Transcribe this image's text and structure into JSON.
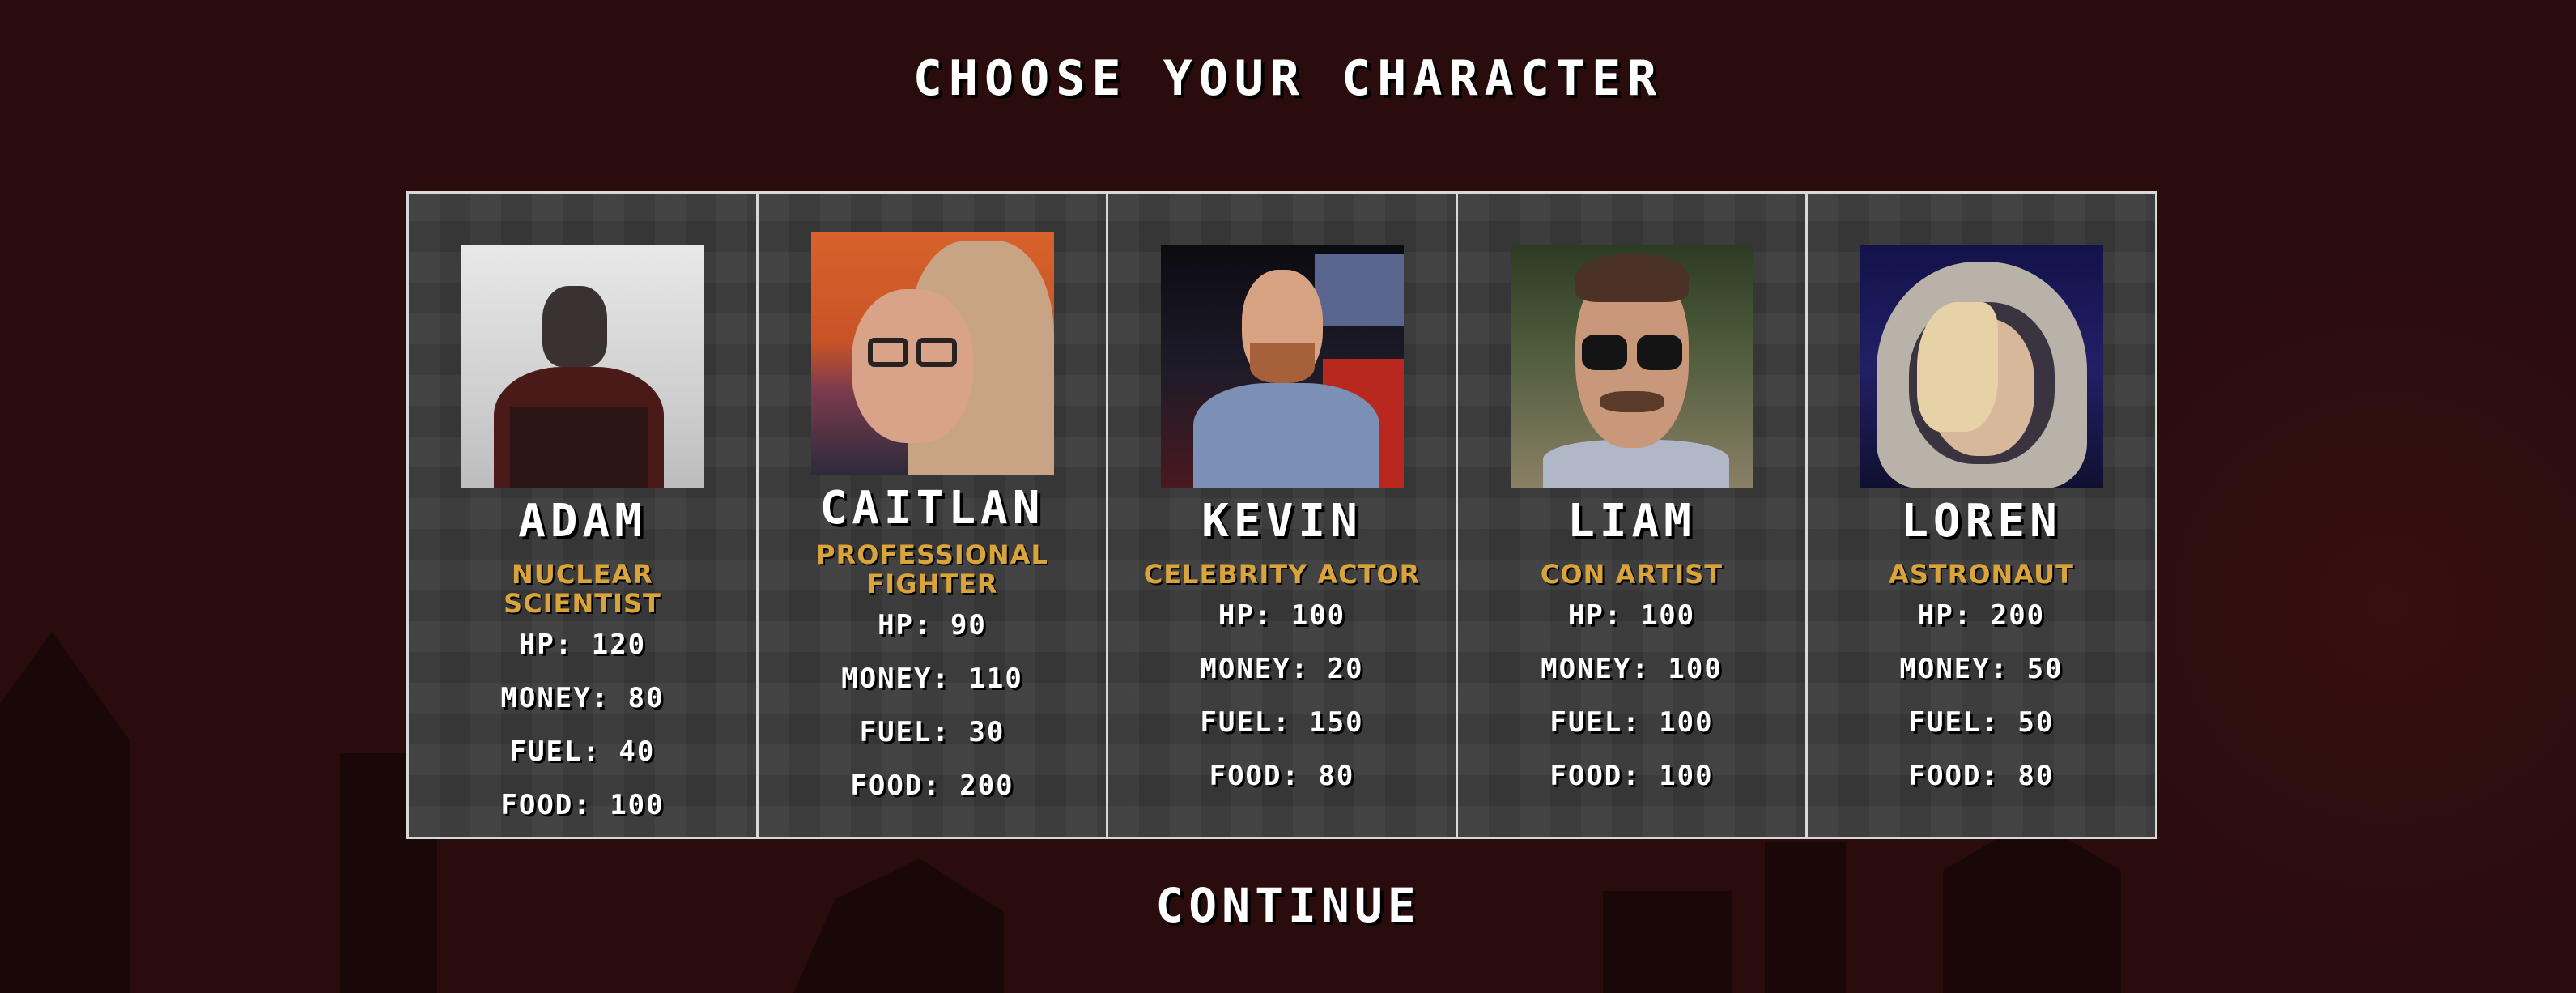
{
  "screen": {
    "title": "CHOOSE YOUR CHARACTER",
    "continue_label": "CONTINUE"
  },
  "characters": [
    {
      "name": "ADAM",
      "role": "NUCLEAR SCIENTIST",
      "hp": "HP: 120",
      "money": "MONEY: 80",
      "fuel": "FUEL: 40",
      "food": "FOOD: 100"
    },
    {
      "name": "CAITLAN",
      "role": "PROFESSIONAL FIGHTER",
      "hp": "HP: 90",
      "money": "MONEY: 110",
      "fuel": "FUEL: 30",
      "food": "FOOD: 200"
    },
    {
      "name": "KEVIN",
      "role": "CELEBRITY ACTOR",
      "hp": "HP: 100",
      "money": "MONEY: 20",
      "fuel": "FUEL: 150",
      "food": "FOOD: 80"
    },
    {
      "name": "LIAM",
      "role": "CON ARTIST",
      "hp": "HP: 100",
      "money": "MONEY: 100",
      "fuel": "FUEL: 100",
      "food": "FOOD: 100"
    },
    {
      "name": "LOREN",
      "role": "ASTRONAUT",
      "hp": "HP: 200",
      "money": "MONEY: 50",
      "fuel": "FUEL: 50",
      "food": "FOOD: 80"
    }
  ],
  "colors": {
    "background": "#2a0c0d",
    "card": "#3b3b3b",
    "card_border": "#d8d8d8",
    "role_text": "#d9a43a",
    "text": "#ffffff"
  }
}
